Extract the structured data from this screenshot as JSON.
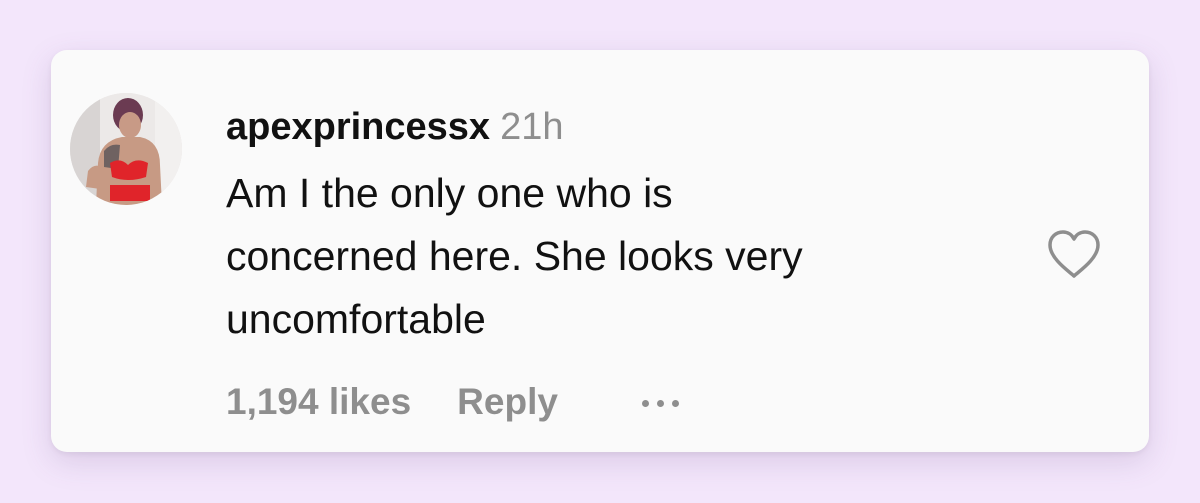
{
  "comment": {
    "username": "apexprincessx",
    "timestamp": "21h",
    "text_lines": [
      "Am I the only one who is",
      "concerned here. She looks very",
      "uncomfortable"
    ],
    "likes": "1,194 likes",
    "reply_label": "Reply",
    "more_icon": "more-horizontal-icon",
    "like_icon": "heart-outline-icon",
    "avatar": "profile-avatar"
  },
  "colors": {
    "page_background": "#f3e6fb",
    "card_background": "#fafafa",
    "primary_text": "#111111",
    "secondary_text": "#8e8e8e"
  }
}
